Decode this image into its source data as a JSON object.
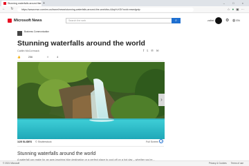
{
  "browser": {
    "tab_title": "Stunning waterfalls around the w",
    "tab_close": "×",
    "new_tab": "+",
    "window_controls": "–  □  ×",
    "nav_buttons": "←  ↻",
    "url": "https://www.msn.com/en-us/travel/news/stunning-waterfalls-around-the-world/ss-AAqVvXGi?ocid=msedgntp"
  },
  "msn": {
    "logo_text": "Microsoft News",
    "search_placeholder": "Search the web",
    "search_icon": "⌕",
    "user_name": "zalbel",
    "settings_icon": "⚙",
    "language": "EN"
  },
  "article": {
    "partner": "Business Communication",
    "title": "Stunning waterfalls around the world",
    "author": "Caitlin McCormack",
    "like_count": "256",
    "reaction_count": "4",
    "slide_counter": "1/25 SLIDES",
    "slide_source": "© Shutterstock",
    "fullscreen_label": "Full Screen",
    "next_arrow": "›",
    "caption_title": "Stunning waterfalls around the world",
    "caption_text": "A waterfall can make for an awe-inspiring hike destination or a perfect place to cool off on a hot day – whether you're..."
  },
  "footer": {
    "copyright": "© 2021 Microsoft",
    "links": [
      "Privacy & Cookies",
      "Terms of use"
    ]
  },
  "colors": {
    "accent": "#1e6fd0",
    "logo_red": "#e81123",
    "pool_blue": "#2dc6d0"
  }
}
